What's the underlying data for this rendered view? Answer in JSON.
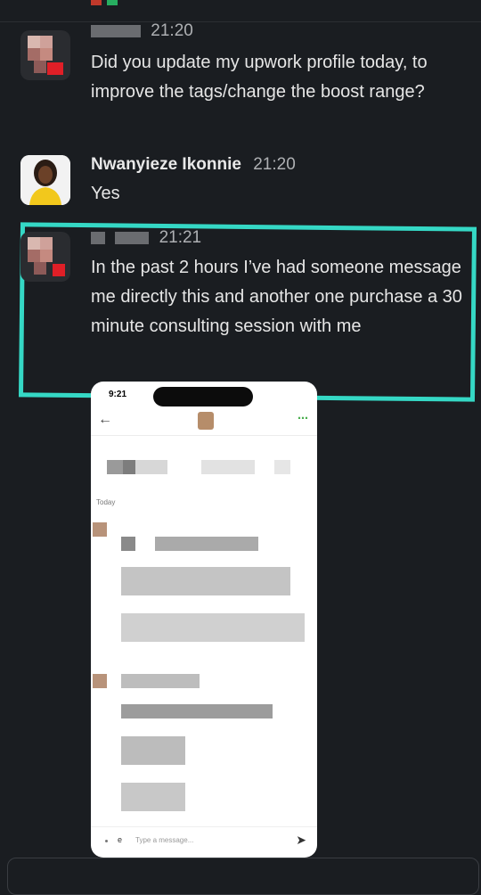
{
  "messages": [
    {
      "time": "21:20",
      "text": "Did you update my upwork profile today, to improve the tags/change the boost range?"
    },
    {
      "name": "Nwanyieze Ikonnie",
      "time": "21:20",
      "text": "Yes"
    },
    {
      "time": "21:21",
      "text": "In the past 2 hours I’ve had someone message me directly this and another one purchase a 30 minute consulting session with me"
    }
  ],
  "phone": {
    "time": "9:21",
    "date_divider": "Today",
    "input_placeholder": "Type a message...",
    "send_icon": "send-arrow",
    "back_icon": "back-arrow",
    "menu_icon": "overflow-dots"
  },
  "colors": {
    "background": "#1a1d21",
    "highlight": "#35d8c5",
    "name": "#e8e8e8"
  }
}
